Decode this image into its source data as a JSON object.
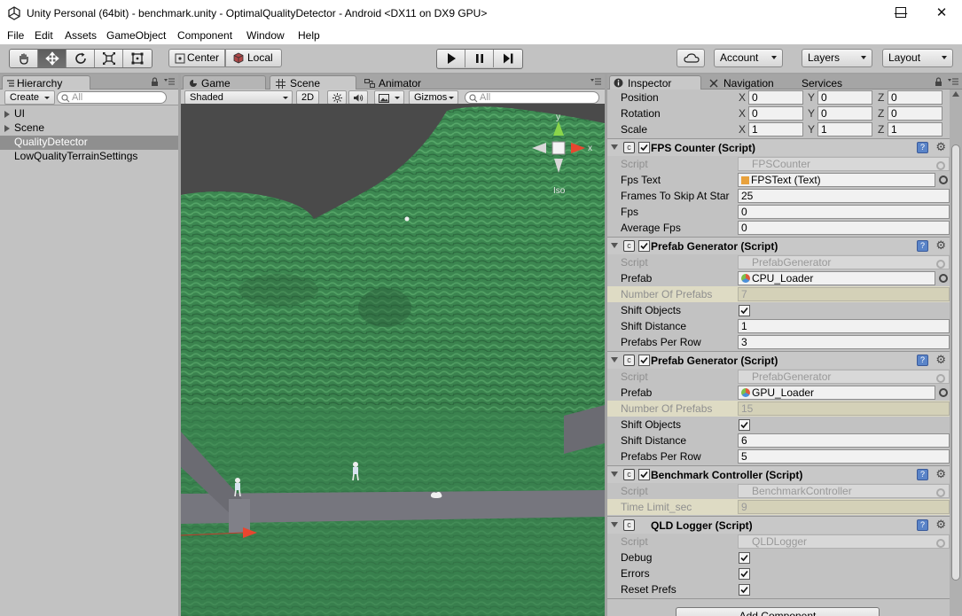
{
  "window": {
    "title": "Unity Personal (64bit) - benchmark.unity - OptimalQualityDetector - Android <DX11 on DX9 GPU>",
    "minimize": "—",
    "maximize": "☐",
    "close": "✕"
  },
  "menu": [
    "File",
    "Edit",
    "Assets",
    "GameObject",
    "Component",
    "Window",
    "Help"
  ],
  "toolbar": {
    "transform_tools": [
      "hand-icon",
      "move-icon",
      "rotate-icon",
      "scale-icon",
      "rect-icon"
    ],
    "active_tool": "move-icon",
    "pivot": "Center",
    "space": "Local",
    "cloud_icon": "cloud-icon",
    "account": "Account",
    "layers": "Layers",
    "layout": "Layout"
  },
  "hierarchy": {
    "tab": "Hierarchy",
    "create": "Create",
    "search_placeholder": "All",
    "items": [
      {
        "label": "UI",
        "has_children": true,
        "selected": false
      },
      {
        "label": "Scene",
        "has_children": true,
        "selected": false
      },
      {
        "label": "QualityDetector",
        "has_children": false,
        "selected": true
      },
      {
        "label": "LowQualityTerrainSettings",
        "has_children": false,
        "selected": false
      }
    ]
  },
  "scene_view": {
    "tabs": [
      {
        "label": "Game",
        "icon": "game-icon"
      },
      {
        "label": "Scene",
        "icon": "scene-icon"
      },
      {
        "label": "Animator",
        "icon": "animator-icon"
      }
    ],
    "active_tab": "Scene",
    "shading": "Shaded",
    "mode_2d": "2D",
    "gizmos": "Gizmos",
    "search_placeholder": "All",
    "gizmo_axes": {
      "y": "y",
      "x": "x"
    },
    "projection": "Iso"
  },
  "inspector": {
    "tabs": [
      "Inspector",
      "Navigation",
      "Services"
    ],
    "active_tab": "Inspector",
    "transform": {
      "position": {
        "label": "Position",
        "x": "0",
        "y": "0",
        "z": "0"
      },
      "rotation": {
        "label": "Rotation",
        "x": "0",
        "y": "0",
        "z": "0"
      },
      "scale": {
        "label": "Scale",
        "x": "1",
        "y": "1",
        "z": "1"
      }
    },
    "axis_labels": {
      "x": "X",
      "y": "Y",
      "z": "Z"
    },
    "fps_counter": {
      "name": "FPS Counter (Script)",
      "script_label": "Script",
      "script": "FPSCounter",
      "fps_text_label": "Fps Text",
      "fps_text": "FPSText (Text)",
      "frames_skip_label": "Frames To Skip At Star",
      "frames_skip": "25",
      "fps_label": "Fps",
      "fps": "0",
      "avg_fps_label": "Average Fps",
      "avg_fps": "0"
    },
    "prefab_gen_1": {
      "name": "Prefab Generator (Script)",
      "script_label": "Script",
      "script": "PrefabGenerator",
      "prefab_label": "Prefab",
      "prefab": "CPU_Loader",
      "num_label": "Number Of Prefabs",
      "num": "7",
      "shift_objects_label": "Shift Objects",
      "shift_objects": true,
      "shift_distance_label": "Shift Distance",
      "shift_distance": "1",
      "per_row_label": "Prefabs Per Row",
      "per_row": "3"
    },
    "prefab_gen_2": {
      "name": "Prefab Generator (Script)",
      "script_label": "Script",
      "script": "PrefabGenerator",
      "prefab_label": "Prefab",
      "prefab": "GPU_Loader",
      "num_label": "Number Of Prefabs",
      "num": "15",
      "shift_objects_label": "Shift Objects",
      "shift_objects": true,
      "shift_distance_label": "Shift Distance",
      "shift_distance": "6",
      "per_row_label": "Prefabs Per Row",
      "per_row": "5"
    },
    "benchmark": {
      "name": "Benchmark Controller (Script)",
      "script_label": "Script",
      "script": "BenchmarkController",
      "time_limit_label": "Time Limit_sec",
      "time_limit": "9"
    },
    "qld_logger": {
      "name": "QLD Logger (Script)",
      "script_label": "Script",
      "script": "QLDLogger",
      "debug_label": "Debug",
      "debug": true,
      "errors_label": "Errors",
      "errors": true,
      "reset_prefs_label": "Reset Prefs",
      "reset_prefs": true
    },
    "add_component": "Add Component"
  },
  "colors": {
    "accent": "#5a84c8",
    "selection": "#8f8f8f",
    "terrain": "#3f8f55",
    "sky": "#4a4a4a"
  }
}
